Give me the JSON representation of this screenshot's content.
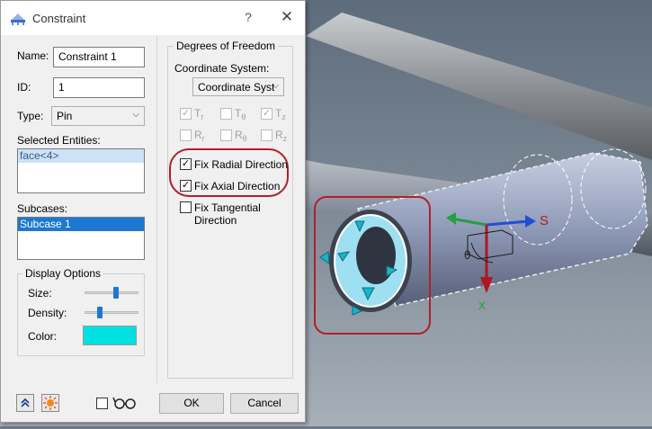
{
  "dialog": {
    "title": "Constraint",
    "help_glyph": "?",
    "close_glyph": "✕",
    "name_label": "Name:",
    "name_value": "Constraint 1",
    "id_label": "ID:",
    "id_value": "1",
    "type_label": "Type:",
    "type_value": "Pin",
    "selected_entities_label": "Selected Entities:",
    "selected_entities": [
      "face<4>"
    ],
    "subcases_label": "Subcases:",
    "subcases": [
      "Subcase 1"
    ],
    "display_options": {
      "legend": "Display Options",
      "size_label": "Size:",
      "size_level": 0.6,
      "density_label": "Density:",
      "density_level": 0.25,
      "color_label": "Color:",
      "color_value": "#00e0e0"
    },
    "dof": {
      "legend": "Degrees of Freedom",
      "coord_label": "Coordinate System:",
      "coord_value": "Coordinate Syst",
      "translations": [
        {
          "main": "T",
          "sub": "r",
          "checked": true
        },
        {
          "main": "T",
          "sub": "θ",
          "checked": false
        },
        {
          "main": "T",
          "sub": "z",
          "checked": true
        }
      ],
      "rotations": [
        {
          "main": "R",
          "sub": "r",
          "checked": false
        },
        {
          "main": "R",
          "sub": "θ",
          "checked": false
        },
        {
          "main": "R",
          "sub": "z",
          "checked": false
        }
      ],
      "fix_radial": "Fix Radial Direction",
      "fix_axial": "Fix Axial Direction",
      "fix_tangential": "Fix Tangential Direction"
    },
    "ok_label": "OK",
    "cancel_label": "Cancel",
    "glasses_glyph": "👓"
  },
  "viewport": {
    "axis_x_label": "X",
    "axis_s_label": "S",
    "theta_label": "θ",
    "highlight_color": "#b41e28",
    "accent": "#1e78d2"
  }
}
